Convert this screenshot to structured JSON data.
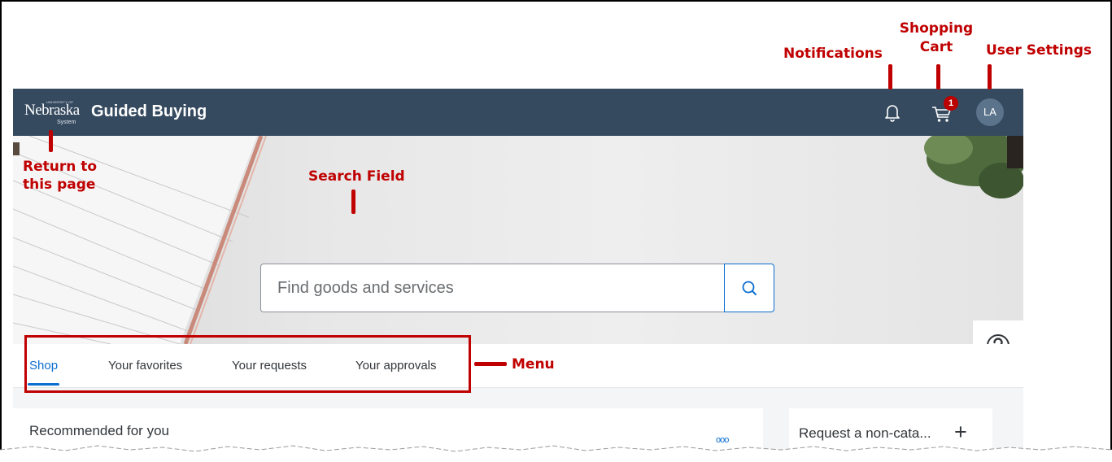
{
  "shellbar": {
    "logo_text": "Nebraska",
    "logo_tiny": "UNIVERSITY OF",
    "logo_system": "System",
    "title": "Guided Buying",
    "cart_count": "1",
    "avatar_initials": "LA"
  },
  "search": {
    "placeholder": "Find goods and services"
  },
  "menu": {
    "tabs": [
      {
        "label": "Shop",
        "active": true
      },
      {
        "label": "Your favorites",
        "active": false
      },
      {
        "label": "Your requests",
        "active": false
      },
      {
        "label": "Your approvals",
        "active": false
      }
    ]
  },
  "cards": {
    "recommended_title": "Recommended for you",
    "more_label": "ooo",
    "request_title": "Request a non-cata..."
  },
  "annotations": {
    "notifications": "Notifications",
    "shopping_cart_line1": "Shopping",
    "shopping_cart_line2": "Cart",
    "user_settings": "User Settings",
    "return_line1": "Return to",
    "return_line2": "this page",
    "search_field": "Search Field",
    "menu": "Menu"
  },
  "colors": {
    "shellbar": "#354a5f",
    "accent": "#0a6ed1",
    "annotation": "#c00000",
    "badge": "#bb0000"
  },
  "icons": {
    "notifications": "bell-icon",
    "cart": "cart-icon",
    "search": "search-icon",
    "help": "help-icon",
    "add": "plus-icon"
  }
}
